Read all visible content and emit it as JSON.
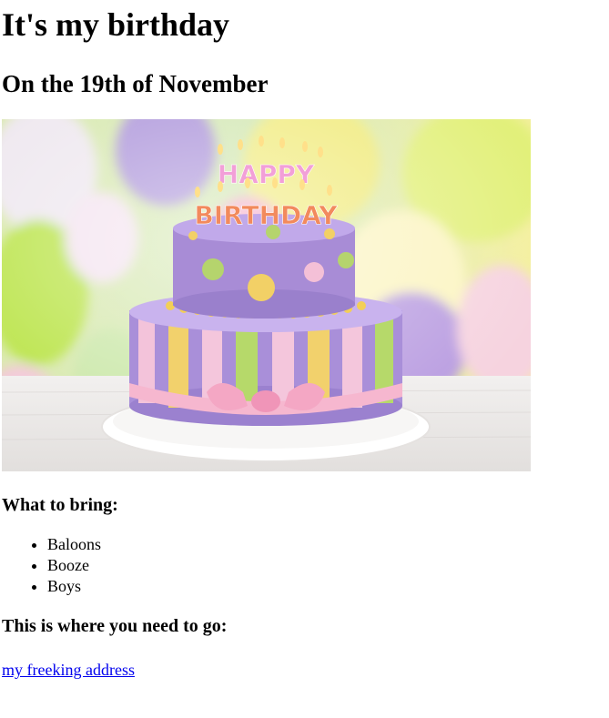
{
  "page": {
    "title": "It's my birthday",
    "subtitle": "On the 19th of November"
  },
  "image": {
    "cake_text_top": "HAPPY",
    "cake_text_bottom": "BIRTHDAY"
  },
  "bring": {
    "heading": "What to bring:",
    "items": [
      "Baloons",
      "Booze",
      "Boys"
    ]
  },
  "directions": {
    "heading": "This is where you need to go:",
    "link_label": "my freeking address"
  },
  "colors": {
    "link": "#0000ee"
  }
}
